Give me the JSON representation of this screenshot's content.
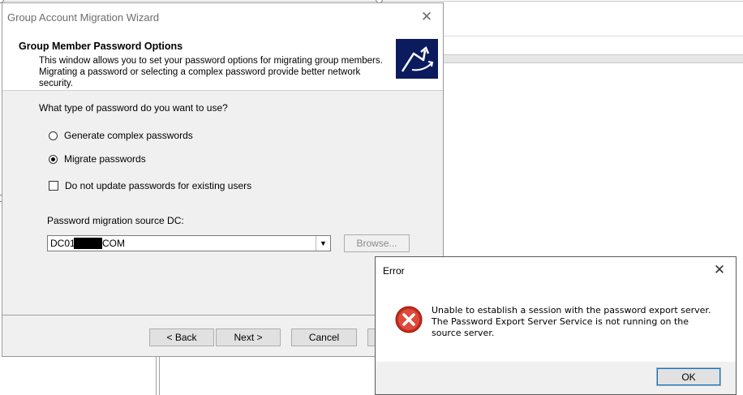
{
  "wizard": {
    "title": "Group Account Migration Wizard",
    "close_glyph": "✕",
    "heading": "Group Member Password Options",
    "description": "This window allows you to set your password options for migrating group members. Migrating a password or selecting a complex password provide better network security.",
    "question": "What type of password do you want to use?",
    "options": [
      {
        "label": "Generate complex passwords",
        "selected": false
      },
      {
        "label": "Migrate passwords",
        "selected": true
      }
    ],
    "checkbox": {
      "label": "Do not update passwords for existing users",
      "checked": false
    },
    "source_dc_label": "Password migration source DC:",
    "source_dc_value_prefix": "DC01",
    "source_dc_value_suffix": "COM",
    "browse_label": "Browse...",
    "buttons": {
      "back": "< Back",
      "next": "Next >",
      "cancel": "Cancel"
    }
  },
  "error_dialog": {
    "title": "Error",
    "close_glyph": "✕",
    "message": "Unable to establish a session with the password export server. The Password Export Server Service is not running on the source server.",
    "ok_label": "OK",
    "icon": "error-icon"
  }
}
